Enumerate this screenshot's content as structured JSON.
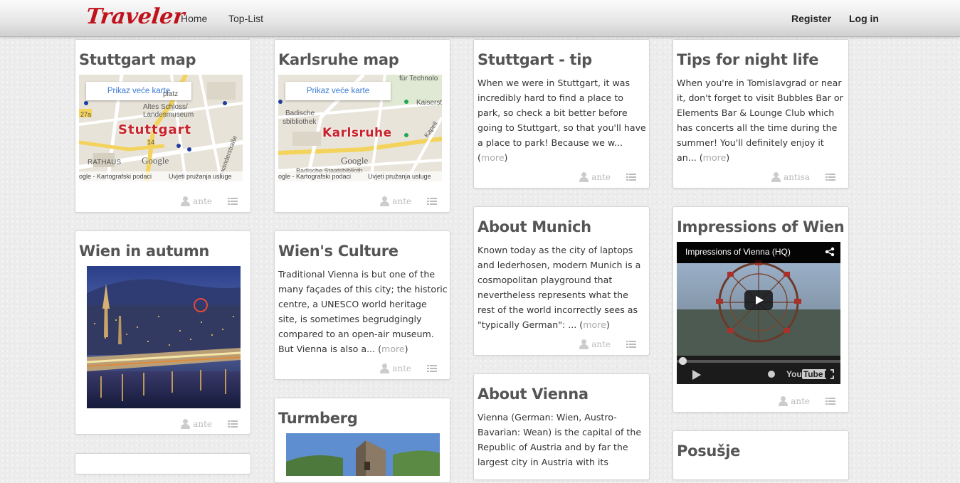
{
  "nav": {
    "brand": "Traveler",
    "home": "Home",
    "toplist": "Top-List",
    "register": "Register",
    "login": "Log in"
  },
  "map_common": {
    "button": "Prikaz veće karte",
    "footer_left": "ogle - Kartografski podaci",
    "footer_right": "Uvjeti pružanja usluge",
    "google": "Google"
  },
  "cards": {
    "stuttgart_map": {
      "title": "Stuttgart map",
      "map_city": "Stuttgart",
      "labels": [
        "platz",
        "Altes Schloss/",
        "Landesmuseum",
        "RATHAUS",
        "Alexanderstraße",
        "27a",
        "14"
      ],
      "author": "ante"
    },
    "karlsruhe_map": {
      "title": "Karlsruhe map",
      "map_city": "Karlsruhe",
      "labels": [
        "für Technolo",
        "Kaiserst",
        "Badische",
        "sbibliothek",
        "Kapell",
        "Badische Staatsbiblioth"
      ],
      "author": "ante"
    },
    "stuttgart_tip": {
      "title": "Stuttgart - tip",
      "text": "When we were in Stuttgart, it was incredibly hard to find a place to park, so check a bit better before going to Stuttgart, so that you'll have a place to park! Because we w...",
      "more": "more",
      "author": "ante"
    },
    "night_life": {
      "title": "Tips for night life",
      "text": "When you're in Tomislavgrad or near it, don't forget to visit Bubbles Bar or Elements Bar & Lounge Club which has concerts all the time during the summer! You'll definitely enjoy it an...",
      "more": "more",
      "author": "antisa"
    },
    "wien_autumn": {
      "title": "Wien in autumn",
      "author": "ante"
    },
    "wien_culture": {
      "title": "Wien's Culture",
      "text": "Traditional Vienna is but one of the many façades of this city; the historic centre, a UNESCO world heritage site, is sometimes begrudgingly compared to an open-air museum. But Vienna is also a...",
      "more": "more",
      "author": "ante"
    },
    "about_munich": {
      "title": "About Munich",
      "text": "Known today as the city of laptops and lederhosen, modern Munich is a cosmopolitan playground that nevertheless represents what the rest of the world incorrectly sees as \"typically German\": ...",
      "more": "more",
      "author": "ante"
    },
    "impressions_wien": {
      "title": "Impressions of Wien",
      "video_title": "Impressions of Vienna (HQ)",
      "youtube": "You",
      "youtube_b": "Tube",
      "author": "ante"
    },
    "turmberg": {
      "title": "Turmberg"
    },
    "about_vienna": {
      "title": "About Vienna",
      "text": "Vienna (German: Wien, Austro-Bavarian: Wean) is the capital of the Republic of Austria and by far the largest city in Austria with its"
    },
    "posusje": {
      "title": "Posušje"
    }
  },
  "colors": {
    "brand": "#c0121b",
    "link_more": "#aaaaaa",
    "map_button_text": "#3a7bd5"
  }
}
